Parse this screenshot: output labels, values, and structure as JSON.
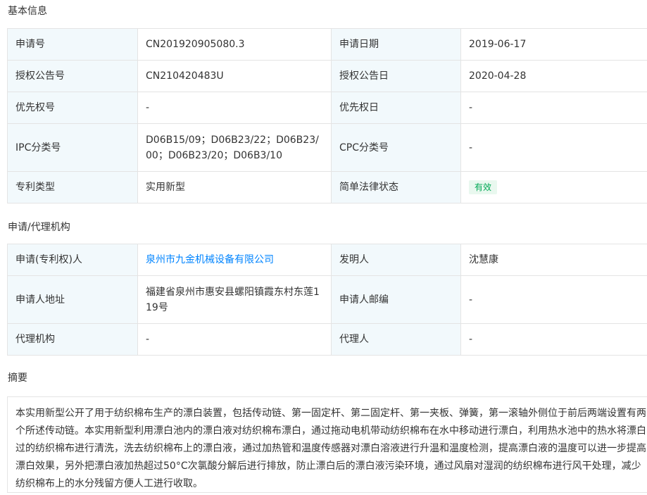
{
  "sections": {
    "basic_info_title": "基本信息",
    "agency_title": "申请/代理机构",
    "abstract_title": "摘要"
  },
  "basic_info": {
    "application_number": {
      "label": "申请号",
      "value": "CN201920905080.3"
    },
    "application_date": {
      "label": "申请日期",
      "value": "2019-06-17"
    },
    "grant_number": {
      "label": "授权公告号",
      "value": "CN210420483U"
    },
    "grant_date": {
      "label": "授权公告日",
      "value": "2020-04-28"
    },
    "priority_number": {
      "label": "优先权号",
      "value": "-"
    },
    "priority_date": {
      "label": "优先权日",
      "value": "-"
    },
    "ipc": {
      "label": "IPC分类号",
      "value": "D06B15/09；D06B23/22；D06B23/00；D06B23/20；D06B3/10"
    },
    "cpc": {
      "label": "CPC分类号",
      "value": "-"
    },
    "patent_type": {
      "label": "专利类型",
      "value": "实用新型"
    },
    "legal_status": {
      "label": "简单法律状态",
      "value": "有效"
    }
  },
  "agency": {
    "applicant": {
      "label": "申请(专利权)人",
      "value": "泉州市九金机械设备有限公司"
    },
    "inventor": {
      "label": "发明人",
      "value": "沈慧康"
    },
    "address": {
      "label": "申请人地址",
      "value": "福建省泉州市惠安县螺阳镇霞东村东莲119号"
    },
    "postcode": {
      "label": "申请人邮编",
      "value": "-"
    },
    "agency_org": {
      "label": "代理机构",
      "value": "-"
    },
    "agent": {
      "label": "代理人",
      "value": "-"
    }
  },
  "abstract": {
    "text": "本实用新型公开了用于纺织棉布生产的漂白装置，包括传动链、第一固定杆、第二固定杆、第一夹板、弹簧，第一滚轴外侧位于前后两端设置有两个所述传动链。本实用新型利用漂白池内的漂白液对纺织棉布漂白，通过拖动电机带动纺织棉布在水中移动进行漂白，利用热水池中的热水将漂白过的纺织棉布进行清洗，洗去纺织棉布上的漂白液，通过加热管和温度传感器对漂白溶液进行升温和温度检测，提高漂白液的温度可以进一步提高漂白效果，另外把漂白液加热超过50°C次氯酸分解后进行排放，防止漂白后的漂白液污染环境，通过风扇对湿润的纺织棉布进行风干处理，减少纺织棉布上的水分残留方便人工进行收取。"
  },
  "colors": {
    "label_bg": "#f2f9fc",
    "border": "#e4e4e4",
    "link": "#0084ff",
    "badge_bg": "#e9f8ef",
    "badge_text": "#00a854"
  }
}
